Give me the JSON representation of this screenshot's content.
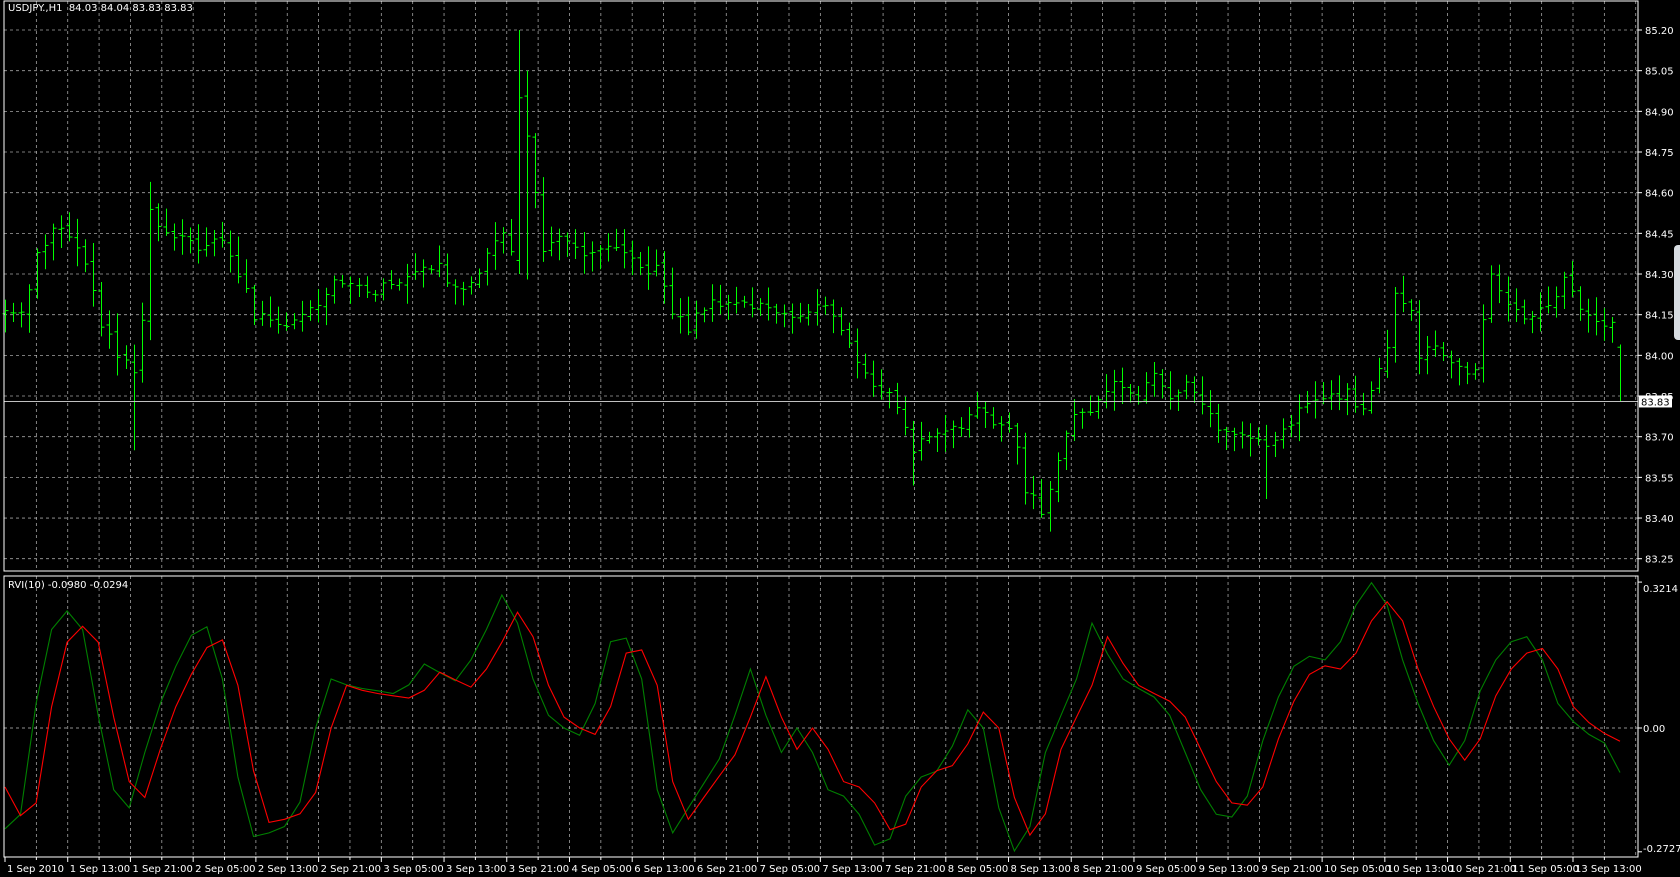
{
  "header": {
    "symbol": "USDJPY.,H1",
    "ohlc": "84.03 84.04 83.83 83.83"
  },
  "indicator": {
    "label": "RVI(10) -0.0980 -0.0294",
    "axis_labels": [
      "0.3214",
      "0.00",
      "-0.2727"
    ],
    "top": 0.3214,
    "bottom": -0.2727,
    "level": 0.0
  },
  "price_axis": {
    "labels": [
      "85.20",
      "85.05",
      "84.90",
      "84.75",
      "84.60",
      "84.45",
      "84.30",
      "84.15",
      "84.00",
      "83.85",
      "83.70",
      "83.55",
      "83.40",
      "83.25"
    ],
    "top": 85.2,
    "step": 0.15,
    "current_price": "83.83"
  },
  "time_axis": {
    "labels": [
      "1 Sep 2010",
      "1 Sep 13:00",
      "1 Sep 21:00",
      "2 Sep 05:00",
      "2 Sep 13:00",
      "2 Sep 21:00",
      "3 Sep 05:00",
      "3 Sep 13:00",
      "3 Sep 21:00",
      "4 Sep 05:00",
      "6 Sep 13:00",
      "6 Sep 21:00",
      "7 Sep 05:00",
      "7 Sep 13:00",
      "7 Sep 21:00",
      "8 Sep 05:00",
      "8 Sep 13:00",
      "8 Sep 21:00",
      "9 Sep 05:00",
      "9 Sep 13:00",
      "9 Sep 21:00",
      "10 Sep 05:00",
      "10 Sep 13:00",
      "10 Sep 21:00",
      "11 Sep 05:00",
      "13 Sep 13:00"
    ]
  },
  "colors": {
    "background": "#000000",
    "bars": "#00ff00",
    "rvi": "#008000",
    "signal": "#ff0000",
    "grid": "#c0c0c0",
    "frame": "#ffffff"
  },
  "chart_data": {
    "type": "ohlc-bars",
    "bar_count": 202,
    "close_path": [
      [
        0,
        84.16
      ],
      [
        2,
        84.14
      ],
      [
        4,
        84.36
      ],
      [
        6,
        84.46
      ],
      [
        8,
        84.44
      ],
      [
        10,
        84.32
      ],
      [
        12,
        84.12
      ],
      [
        14,
        84.0
      ],
      [
        16,
        83.94
      ],
      [
        17,
        84.12
      ],
      [
        18,
        84.52
      ],
      [
        20,
        84.44
      ],
      [
        22,
        84.42
      ],
      [
        25,
        84.4
      ],
      [
        27,
        84.42
      ],
      [
        28,
        84.36
      ],
      [
        30,
        84.24
      ],
      [
        31,
        84.14
      ],
      [
        33,
        84.14
      ],
      [
        35,
        84.12
      ],
      [
        37,
        84.16
      ],
      [
        39,
        84.2
      ],
      [
        41,
        84.28
      ],
      [
        42,
        84.28
      ],
      [
        44,
        84.24
      ],
      [
        46,
        84.24
      ],
      [
        48,
        84.26
      ],
      [
        50,
        84.3
      ],
      [
        52,
        84.34
      ],
      [
        54,
        84.32
      ],
      [
        56,
        84.24
      ],
      [
        58,
        84.28
      ],
      [
        60,
        84.36
      ],
      [
        62,
        84.46
      ],
      [
        63,
        84.4
      ],
      [
        64,
        84.95
      ],
      [
        65,
        84.8
      ],
      [
        67,
        84.4
      ],
      [
        69,
        84.42
      ],
      [
        71,
        84.4
      ],
      [
        73,
        84.36
      ],
      [
        75,
        84.4
      ],
      [
        77,
        84.36
      ],
      [
        79,
        84.32
      ],
      [
        81,
        84.32
      ],
      [
        83,
        84.16
      ],
      [
        85,
        84.1
      ],
      [
        87,
        84.18
      ],
      [
        89,
        84.2
      ],
      [
        91,
        84.2
      ],
      [
        93,
        84.18
      ],
      [
        95,
        84.18
      ],
      [
        97,
        84.16
      ],
      [
        99,
        84.14
      ],
      [
        101,
        84.18
      ],
      [
        103,
        84.16
      ],
      [
        105,
        84.04
      ],
      [
        107,
        83.92
      ],
      [
        109,
        83.88
      ],
      [
        111,
        83.82
      ],
      [
        113,
        83.65
      ],
      [
        115,
        83.71
      ],
      [
        117,
        83.73
      ],
      [
        119,
        83.75
      ],
      [
        121,
        83.79
      ],
      [
        123,
        83.75
      ],
      [
        125,
        83.75
      ],
      [
        126,
        83.65
      ],
      [
        127,
        83.51
      ],
      [
        129,
        83.43
      ],
      [
        130,
        83.49
      ],
      [
        131,
        83.61
      ],
      [
        133,
        83.8
      ],
      [
        135,
        83.79
      ],
      [
        137,
        83.88
      ],
      [
        139,
        83.9
      ],
      [
        141,
        83.84
      ],
      [
        143,
        83.92
      ],
      [
        145,
        83.86
      ],
      [
        147,
        83.9
      ],
      [
        149,
        83.82
      ],
      [
        151,
        83.73
      ],
      [
        153,
        83.71
      ],
      [
        155,
        83.69
      ],
      [
        157,
        83.65
      ],
      [
        159,
        83.71
      ],
      [
        161,
        83.8
      ],
      [
        163,
        83.84
      ],
      [
        165,
        83.84
      ],
      [
        167,
        83.86
      ],
      [
        169,
        83.8
      ],
      [
        171,
        83.94
      ],
      [
        172,
        84.04
      ],
      [
        173,
        84.24
      ],
      [
        175,
        84.18
      ],
      [
        176,
        84.0
      ],
      [
        178,
        84.04
      ],
      [
        180,
        83.96
      ],
      [
        182,
        83.94
      ],
      [
        183,
        83.96
      ],
      [
        185,
        84.28
      ],
      [
        186,
        84.24
      ],
      [
        188,
        84.16
      ],
      [
        190,
        84.14
      ],
      [
        192,
        84.18
      ],
      [
        194,
        84.28
      ],
      [
        196,
        84.18
      ],
      [
        198,
        84.12
      ],
      [
        200,
        84.12
      ],
      [
        201,
        83.83
      ]
    ],
    "bar_overrides": {
      "16": {
        "low": 83.65
      },
      "18": {
        "high": 84.64
      },
      "64": {
        "open": 84.35,
        "high": 85.2,
        "low": 84.3,
        "close": 84.95
      },
      "65": {
        "high": 85.05,
        "low": 84.28
      },
      "113": {
        "low": 83.52
      },
      "130": {
        "low": 83.35
      },
      "157": {
        "low": 83.47
      },
      "201": {
        "open": 84.03,
        "high": 84.04,
        "low": 83.83,
        "close": 83.83
      }
    },
    "rvi": {
      "name": "RVI(10)",
      "main": [
        -0.222,
        -0.19,
        0.054,
        0.217,
        0.258,
        0.217,
        0.028,
        -0.136,
        -0.176,
        -0.054,
        0.054,
        0.136,
        0.204,
        0.223,
        0.108,
        -0.108,
        -0.239,
        -0.231,
        -0.217,
        -0.163,
        0,
        0.108,
        0.095,
        0.087,
        0.082,
        0.076,
        0.095,
        0.141,
        0.122,
        0.104,
        0.15,
        0.217,
        0.293,
        0.231,
        0.108,
        0.028,
        0,
        -0.016,
        0.054,
        0.19,
        0.198,
        0.108,
        -0.136,
        -0.231,
        -0.176,
        -0.122,
        -0.068,
        0.028,
        0.13,
        0.028,
        -0.054,
        0,
        -0.054,
        -0.136,
        -0.15,
        -0.19,
        -0.258,
        -0.244,
        -0.15,
        -0.108,
        -0.095,
        -0.04,
        0.04,
        0,
        -0.176,
        -0.271,
        -0.217,
        -0.054,
        0.028,
        0.108,
        0.231,
        0.163,
        0.108,
        0.087,
        0.068,
        0.028,
        -0.054,
        -0.136,
        -0.19,
        -0.196,
        -0.15,
        -0.028,
        0.068,
        0.136,
        0.158,
        0.15,
        0.19,
        0.271,
        0.32,
        0.271,
        0.15,
        0.054,
        -0.028,
        -0.082,
        -0.028,
        0.082,
        0.15,
        0.19,
        0.201,
        0.15,
        0.054,
        0.014,
        -0.014,
        -0.033,
        -0.098
      ],
      "signal": [
        -0.13,
        -0.193,
        -0.165,
        0.047,
        0.189,
        0.224,
        0.189,
        0.024,
        -0.118,
        -0.153,
        -0.047,
        0.047,
        0.118,
        0.177,
        0.194,
        0.094,
        -0.094,
        -0.208,
        -0.201,
        -0.189,
        -0.142,
        0,
        0.094,
        0.083,
        0.076,
        0.071,
        0.066,
        0.083,
        0.123,
        0.106,
        0.09,
        0.13,
        0.189,
        0.255,
        0.201,
        0.094,
        0.024,
        0,
        -0.014,
        0.047,
        0.165,
        0.172,
        0.094,
        -0.118,
        -0.201,
        -0.153,
        -0.106,
        -0.059,
        0.024,
        0.113,
        0.024,
        -0.047,
        0,
        -0.047,
        -0.118,
        -0.13,
        -0.165,
        -0.224,
        -0.212,
        -0.13,
        -0.094,
        -0.083,
        -0.035,
        0.035,
        0,
        -0.153,
        -0.236,
        -0.189,
        -0.047,
        0.024,
        0.094,
        0.201,
        0.142,
        0.094,
        0.076,
        0.059,
        0.024,
        -0.047,
        -0.118,
        -0.165,
        -0.17,
        -0.13,
        -0.024,
        0.059,
        0.118,
        0.137,
        0.13,
        0.165,
        0.236,
        0.278,
        0.236,
        0.13,
        0.047,
        -0.024,
        -0.071,
        -0.024,
        0.071,
        0.13,
        0.165,
        0.175,
        0.13,
        0.047,
        0.012,
        -0.012,
        -0.029
      ]
    }
  }
}
